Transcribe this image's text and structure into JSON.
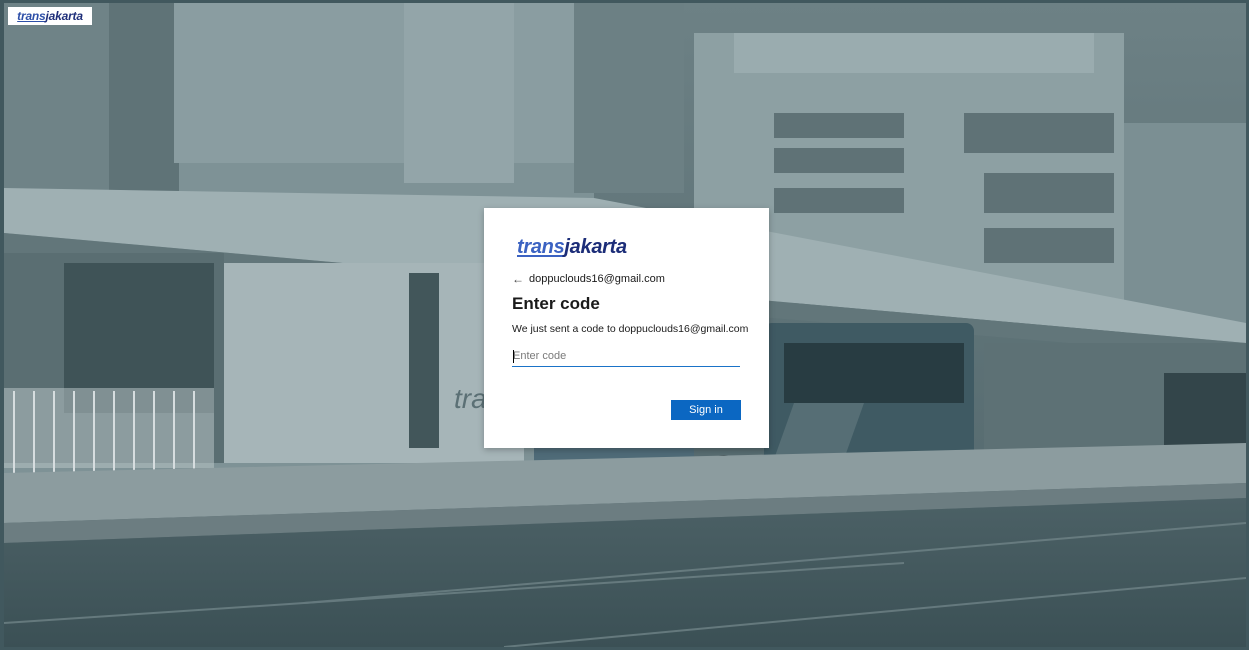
{
  "corner_logo": {
    "part1": "trans",
    "part2": "jakarta"
  },
  "background": {
    "sign_text": "trans"
  },
  "dialog": {
    "logo": {
      "part1": "trans",
      "part2": "jakarta"
    },
    "back_arrow": "←",
    "email": "doppuclouds16@gmail.com",
    "title": "Enter code",
    "description": "We just sent a code to doppuclouds16@gmail.com",
    "code_input": {
      "value": "",
      "placeholder": "Enter code"
    },
    "signin_label": "Sign in"
  },
  "colors": {
    "primary_button": "#0b67c2",
    "input_underline": "#1a73c8",
    "logo_light": "#3b62c2",
    "logo_dark": "#1c2d78",
    "background_tint": "#41585e"
  }
}
